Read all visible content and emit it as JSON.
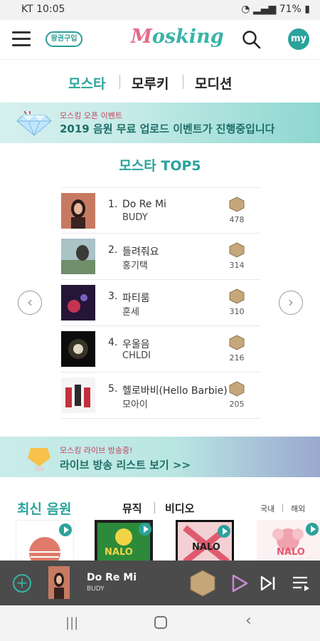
{
  "status": {
    "carrier_time": "KT 10:05",
    "battery": "71%"
  },
  "header": {
    "voucher_label": "왕권구입",
    "logo_text": "osking",
    "my_label": "my"
  },
  "tabs": [
    {
      "label": "모스타"
    },
    {
      "label": "모루키"
    },
    {
      "label": "모디션"
    }
  ],
  "banner1": {
    "small": "모스킹 오픈 이벤트",
    "big": "2019 음원 무료 업로드 이벤트가 진행중입니다"
  },
  "top5": {
    "title": "모스타 TOP5",
    "rows": [
      {
        "rank": "1.",
        "song": "Do Re Mi",
        "artist": "BUDY",
        "count": "478"
      },
      {
        "rank": "2.",
        "song": "들려줘요",
        "artist": "홍기택",
        "count": "314"
      },
      {
        "rank": "3.",
        "song": "파티룸",
        "artist": "훈세",
        "count": "310"
      },
      {
        "rank": "4.",
        "song": "우울음",
        "artist": "CHLDI",
        "count": "216"
      },
      {
        "rank": "5.",
        "song": "헬로바비(Hello Barbie)",
        "artist": "모아이",
        "count": "205"
      }
    ]
  },
  "banner2": {
    "small": "모스킹 라이브 방송중!",
    "big": "라이브 방송 리스트 보기 >>"
  },
  "latest": {
    "title": "최신 음원",
    "tab_music": "뮤직",
    "tab_video": "비디오",
    "region_domestic": "국내",
    "region_foreign": "해외",
    "album_texts": [
      "NALO",
      "NALO",
      "NALO"
    ]
  },
  "player": {
    "song": "Do Re Mi",
    "artist": "BUDY"
  },
  "colors": {
    "accent": "#2aa39b",
    "pink": "#e66b8b",
    "player_bg": "#4b4b4b"
  }
}
